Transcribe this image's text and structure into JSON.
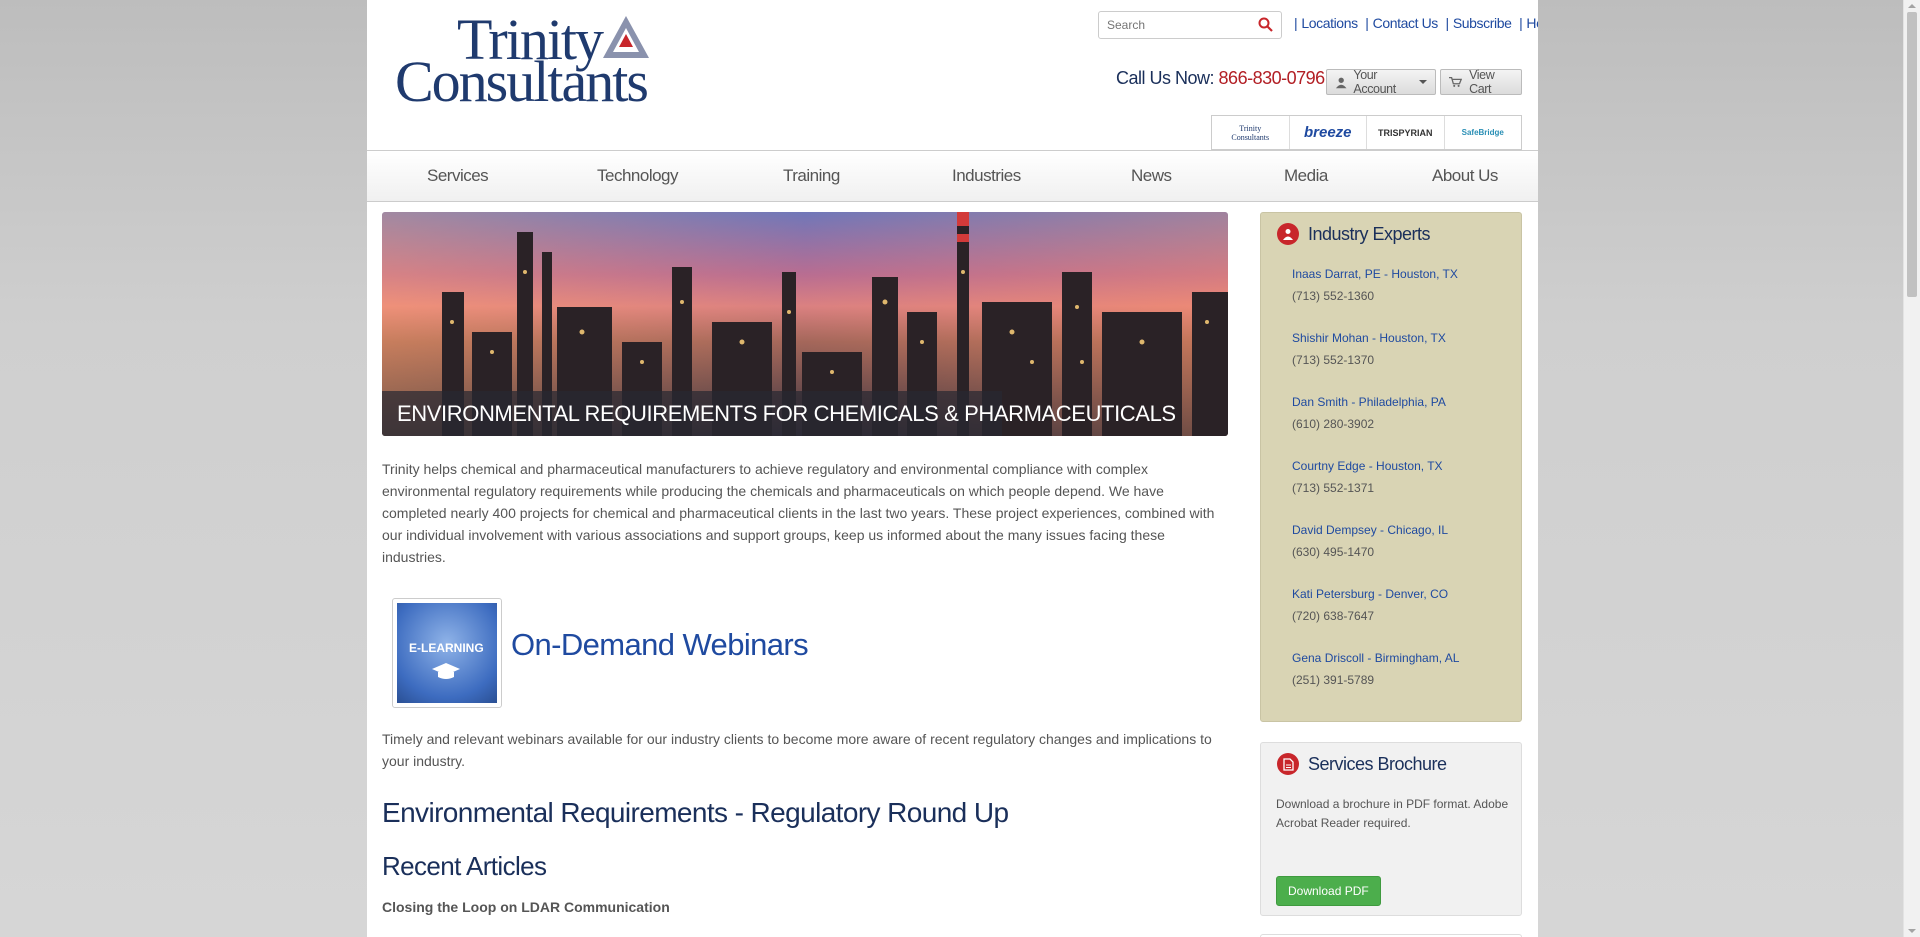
{
  "header": {
    "logo_line1": "Trinity",
    "logo_line2": "Consultants",
    "search_placeholder": "Search",
    "links": [
      "Locations",
      "Contact Us",
      "Subscribe",
      "Help"
    ],
    "call_label": "Call Us Now:",
    "phone": "866-830-0796",
    "account_label": "Your Account",
    "cart_label": "View Cart",
    "brands": [
      "Trinity Consultants",
      "breeze",
      "TRISPYRIAN",
      "SafeBridge"
    ]
  },
  "nav": {
    "items": [
      "Services",
      "Technology",
      "Training",
      "Industries",
      "News",
      "Media",
      "About Us"
    ]
  },
  "main": {
    "hero_caption": "ENVIRONMENTAL REQUIREMENTS FOR CHEMICALS & PHARMACEUTICALS",
    "intro": "Trinity helps chemical and pharmaceutical manufacturers to achieve regulatory and environmental compliance with complex environmental regulatory requirements while producing the chemicals and pharmaceuticals on which people depend.  We have completed nearly 400 projects for chemical and pharmaceutical clients in the last two years.  These project experiences, combined with our individual involvement with various associations and support groups, keep us informed about the many issues facing these industries.",
    "elearning_label": "E-LEARNING",
    "webinars_title": "On-Demand Webinars",
    "webinars_desc": "Timely and relevant webinars available for our industry clients to become more aware of recent regulatory changes and implications to your industry.",
    "regulatory_heading": "Environmental Requirements - Regulatory Round Up",
    "recent_heading": "Recent Articles",
    "articles": [
      "Closing the Loop on LDAR Communication"
    ]
  },
  "sidebar": {
    "experts_title": "Industry Experts",
    "experts": [
      {
        "name": "Inaas Darrat, PE - Houston, TX",
        "phone": "(713) 552-1360"
      },
      {
        "name": "Shishir Mohan - Houston, TX",
        "phone": "(713) 552-1370"
      },
      {
        "name": "Dan Smith - Philadelphia, PA",
        "phone": "(610) 280-3902"
      },
      {
        "name": "Courtny Edge - Houston, TX",
        "phone": "(713) 552-1371"
      },
      {
        "name": "David Dempsey - Chicago, IL",
        "phone": "(630) 495-1470"
      },
      {
        "name": "Kati Petersburg - Denver, CO",
        "phone": "(720) 638-7647"
      },
      {
        "name": "Gena Driscoll - Birmingham, AL",
        "phone": "(251) 391-5789"
      }
    ],
    "brochure_title": "Services Brochure",
    "brochure_text": "Download a brochure in PDF format. Adobe Acrobat Reader required.",
    "download_label": "Download PDF"
  },
  "colors": {
    "brand_navy": "#1a2f5a",
    "link_blue": "#1f4aa0",
    "phone_red": "#b21e24",
    "experts_bg": "#d9d4b4",
    "download_green": "#4cae4c"
  }
}
